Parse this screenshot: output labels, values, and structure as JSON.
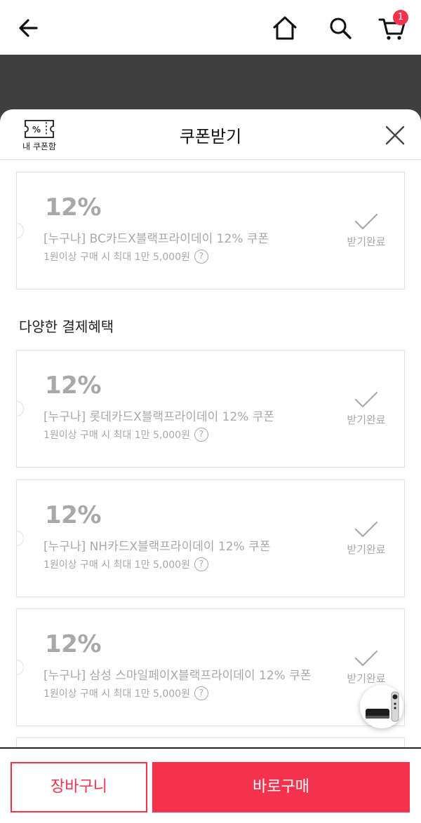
{
  "header": {
    "cart_count": "1"
  },
  "sheet": {
    "title": "쿠폰받기",
    "my_coupon_label": "내 쿠폰함"
  },
  "coupons": [
    {
      "discount": "12%",
      "name": "[누구나] BC카드X블랙프라이데이 12% 쿠폰",
      "condition": "1원이상 구매 시 최대 1만 5,000원",
      "status": "받기완료"
    }
  ],
  "section": {
    "title": "다양한 결제혜택"
  },
  "payment_coupons": [
    {
      "discount": "12%",
      "name": "[누구나] 롯데카드X블랙프라이데이 12% 쿠폰",
      "condition": "1원이상 구매 시 최대 1만 5,000원",
      "status": "받기완료"
    },
    {
      "discount": "12%",
      "name": "[누구나] NH카드X블랙프라이데이 12% 쿠폰",
      "condition": "1원이상 구매 시 최대 1만 5,000원",
      "status": "받기완료"
    },
    {
      "discount": "12%",
      "name": "[누구나] 삼성 스마일페이X블랙프라이데이 12% 쿠폰",
      "condition": "1원이상 구매 시 최대 1만 5,000원",
      "status": "받기완료"
    }
  ],
  "question_mark": "?",
  "bottom": {
    "cart_button": "장바구니",
    "buy_button": "바로구매"
  },
  "colors": {
    "accent": "#f5334e",
    "muted_text": "#a8a8a8",
    "border": "#e2e2e2"
  }
}
